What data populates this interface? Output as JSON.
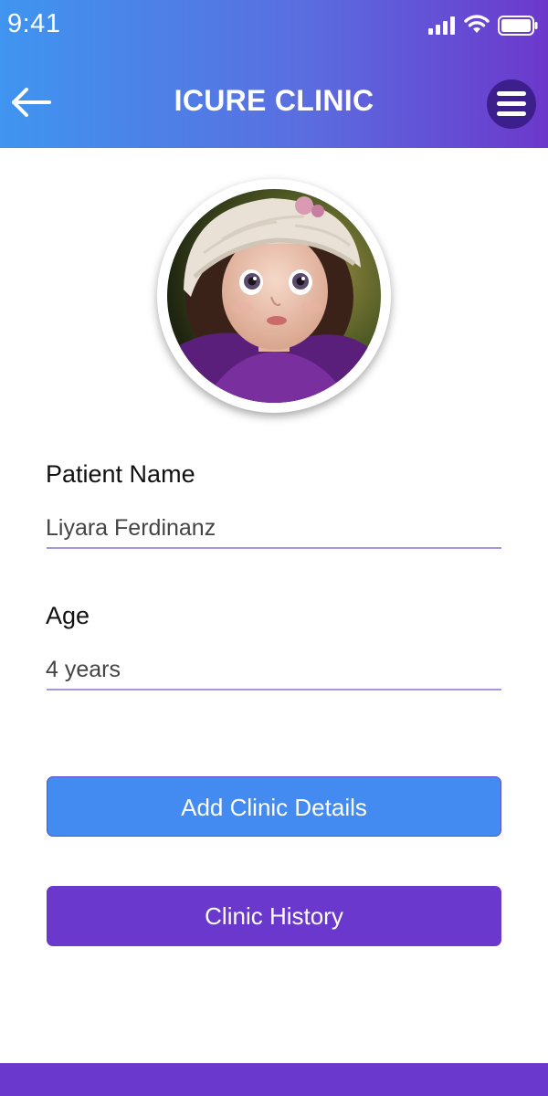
{
  "status_bar": {
    "time": "9:41"
  },
  "header": {
    "title": "ICURE CLINIC"
  },
  "icons": {
    "back": "back-arrow-icon",
    "menu": "hamburger-menu-icon",
    "signal": "cellular-signal-icon",
    "wifi": "wifi-icon",
    "battery": "battery-icon"
  },
  "form": {
    "patient_name_label": "Patient Name",
    "patient_name_value": "Liyara Ferdinanz",
    "age_label": "Age",
    "age_value": "4 years"
  },
  "actions": {
    "add_clinic_details": "Add Clinic Details",
    "clinic_history": "Clinic History"
  },
  "colors": {
    "header_gradient_start": "#3f95f0",
    "header_gradient_end": "#6c38cc",
    "menu_button": "#3d1e8d",
    "primary_blue": "#438bf1",
    "primary_purple": "#6a38cc",
    "field_underline": "#a795e0"
  }
}
